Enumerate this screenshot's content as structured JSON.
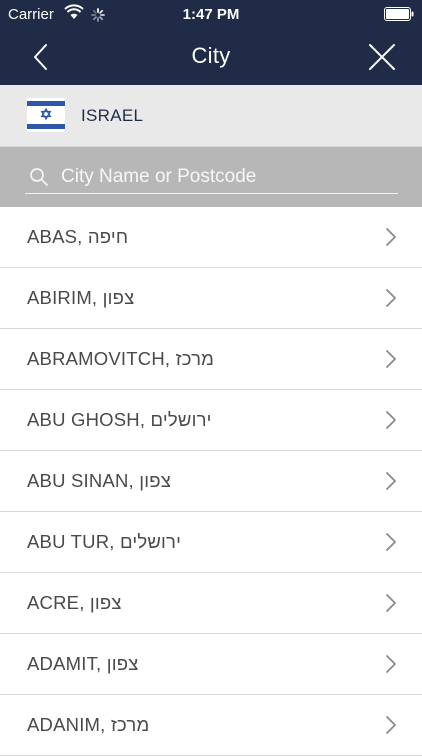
{
  "status_bar": {
    "carrier": "Carrier",
    "time": "1:47 PM"
  },
  "nav": {
    "title": "City"
  },
  "country": {
    "name": "ISRAEL",
    "flag_icon": "israel-flag-icon"
  },
  "search": {
    "placeholder": "City Name or Postcode",
    "value": ""
  },
  "cities": [
    {
      "label": "ABAS, חיפה"
    },
    {
      "label": "ABIRIM, צפון"
    },
    {
      "label": "ABRAMOVITCH, מרכז"
    },
    {
      "label": "ABU GHOSH, ירושלים"
    },
    {
      "label": "ABU SINAN, צפון"
    },
    {
      "label": "ABU TUR, ירושלים"
    },
    {
      "label": "ACRE, צפון"
    },
    {
      "label": "ADAMIT, צפון"
    },
    {
      "label": "ADANIM, מרכז"
    }
  ],
  "colors": {
    "header": "#1f2b47",
    "country_bg": "#e9e9e9",
    "search_bg": "#b7b7b7",
    "flag_blue": "#2f57a8"
  }
}
